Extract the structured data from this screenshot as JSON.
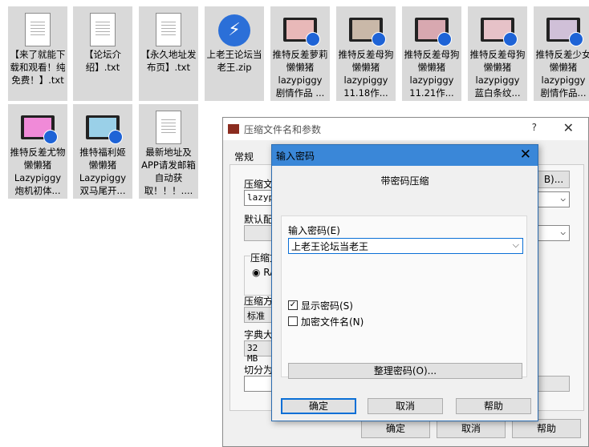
{
  "desktop": {
    "files": [
      {
        "name": "【来了就能下载和观看！纯免费！】.txt",
        "icon": "text-file-icon"
      },
      {
        "name": "【论坛介绍】.txt",
        "icon": "text-file-icon"
      },
      {
        "name": "【永久地址发布页】.txt",
        "icon": "text-file-icon"
      },
      {
        "name": "上老王论坛当老王.zip",
        "icon": "zip-archive-icon"
      },
      {
        "name": "推特反差萝莉 懒懒猪 lazypiggy 剧情作品 ...",
        "icon": "video-file-icon"
      },
      {
        "name": "推特反差母狗 懒懒猪 lazypiggy 11.18作...",
        "icon": "video-file-icon"
      },
      {
        "name": "推特反差母狗 懒懒猪 lazypiggy 11.21作...",
        "icon": "video-file-icon"
      },
      {
        "name": "推特反差母狗 懒懒猪 lazypiggy 蓝白条纹...",
        "icon": "video-file-icon"
      },
      {
        "name": "推特反差少女 懒懒猪 lazypiggy 剧情作品...",
        "icon": "video-file-icon"
      },
      {
        "name": "推特反差尤物 懒懒猪 Lazypiggy 炮机初体...",
        "icon": "video-file-icon"
      },
      {
        "name": "推特福利姬 懒懒猪 Lazypiggy 双马尾开...",
        "icon": "video-file-icon"
      },
      {
        "name": "最新地址及APP请发邮箱自动获取！！！....",
        "icon": "text-file-icon"
      }
    ]
  },
  "archive_window": {
    "title": "压缩文件名和参数",
    "help_glyph": "?",
    "close_glyph": "✕",
    "tab_general": "常规",
    "archive_name_label": "压缩文",
    "archive_name_value": "lazyp",
    "browse_label": "B)...",
    "default_profile_label": "默认配",
    "format_label": "压缩文",
    "format_radio": "RA",
    "method_label": "压缩方",
    "method_value": "标准",
    "dict_label": "字典大",
    "dict_value": "32 MB",
    "split_label": "切分为",
    "ok": "确定",
    "cancel": "取消",
    "help": "帮助"
  },
  "password_dialog": {
    "title": "输入密码",
    "close_glyph": "✕",
    "heading": "带密码压缩",
    "password_label": "输入密码(E)",
    "password_value": "上老王论坛当老王",
    "show_password_label": "显示密码(S)",
    "show_password_checked": true,
    "encrypt_names_label": "加密文件名(N)",
    "encrypt_names_checked": false,
    "organize_button": "整理密码(O)...",
    "ok": "确定",
    "cancel": "取消",
    "help": "帮助",
    "accent_color": "#3a87d8"
  }
}
